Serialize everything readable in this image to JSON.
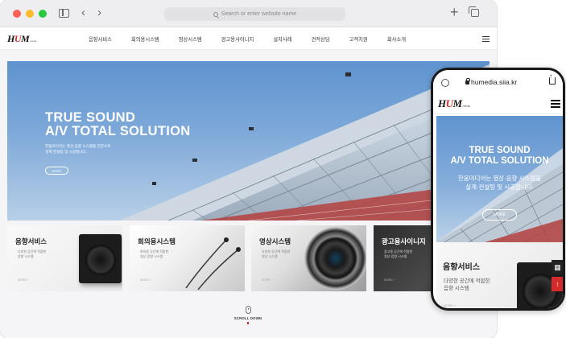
{
  "browser": {
    "address_placeholder": "Search or enter website name",
    "icons": [
      "sidebar-icon",
      "back-icon",
      "forward-icon",
      "search-icon",
      "new-tab-icon",
      "tabs-overview-icon"
    ]
  },
  "site": {
    "logo_text": "HUM",
    "logo_sub": "media",
    "menu": [
      "음향서비스",
      "회의용시스템",
      "영상시스템",
      "광고용사이니지",
      "설치사례",
      "견적상담",
      "고객지원",
      "회사소개"
    ],
    "accent_color": "#d22222"
  },
  "hero": {
    "title_line1": "TRUE SOUND",
    "title_line2": "A/V TOTAL SOLUTION",
    "desc_line1": "한움미디어는 영상·음향 시스템을 전문으로",
    "desc_line2": "설계·컨설팅 및 시공합니다.",
    "more_label": "MORE"
  },
  "services": [
    {
      "title": "음향서비스",
      "desc1": "다양한 공간에 적합한",
      "desc2": "음향 시스템",
      "more": "MORE +"
    },
    {
      "title": "회의용시스템",
      "desc1": "회의용 공간에 적합한",
      "desc2": "영상·음향 시스템",
      "more": "MORE +"
    },
    {
      "title": "영상시스템",
      "desc1": "다양한 공간에 적합한",
      "desc2": "영상 시스템",
      "more": "MORE +"
    },
    {
      "title": "광고용사이니지",
      "desc1": "광고용 공간에 적합한",
      "desc2": "영상·음향 시스템",
      "more": "MORE +"
    }
  ],
  "scroll_label": "SCROLL DOWN",
  "phone": {
    "url": "humedia.siia.kr",
    "hero_title_line1": "TRUE SOUND",
    "hero_title_line2": "A/V TOTAL SOLUTION",
    "hero_desc_line1": "한움미디어는 영상·음향 시스템을",
    "hero_desc_line2": "설계·컨설팅 및 시공합니다.",
    "more_label": "MORE",
    "card_title": "음향서비스",
    "card_desc1": "다양한 공간에 적합한",
    "card_desc2": "음향 시스템",
    "card_more": "MORE +",
    "qr_glyph": "▦",
    "top_glyph": "↑"
  }
}
